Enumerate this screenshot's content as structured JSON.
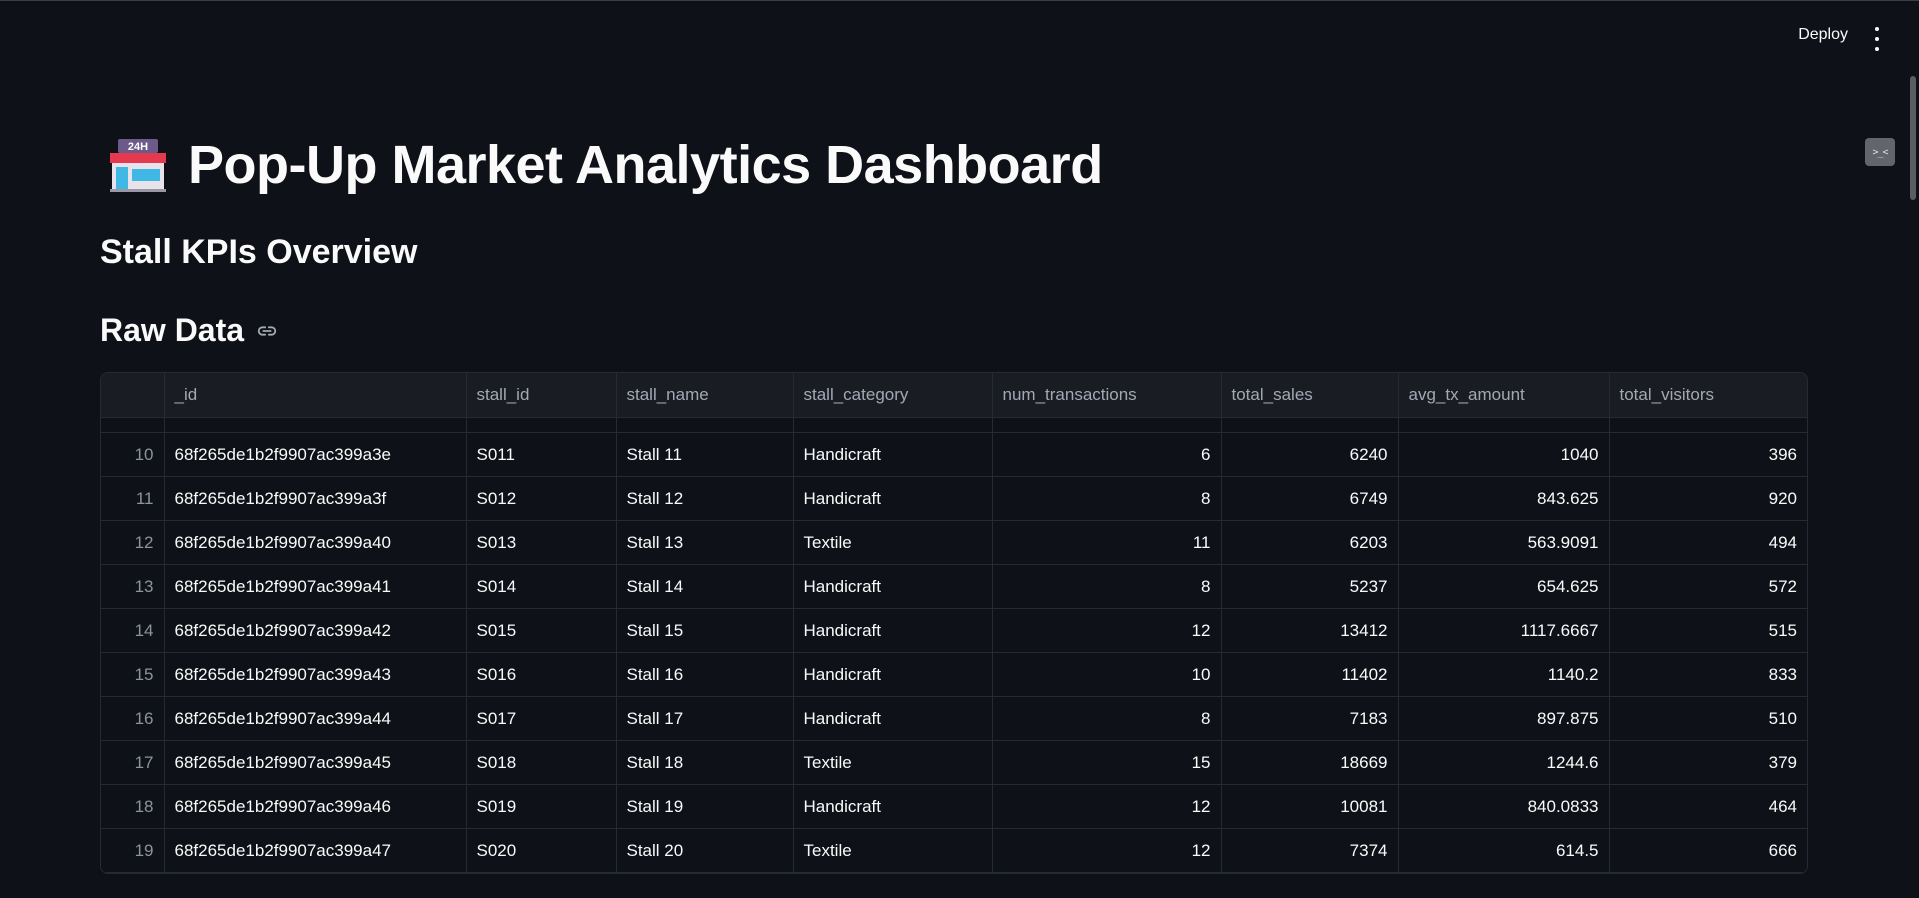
{
  "header": {
    "deploy_label": "Deploy",
    "menu_icon": "vertical-ellipsis-icon",
    "side_widget_text": ">_<"
  },
  "page": {
    "title_icon": "convenience-store-24h-icon",
    "title": "Pop-Up Market Analytics Dashboard",
    "subheader": "Stall KPIs Overview",
    "raw_data_title": "Raw Data",
    "link_icon": "link-icon"
  },
  "table": {
    "columns": [
      "",
      "_id",
      "stall_id",
      "stall_name",
      "stall_category",
      "num_transactions",
      "total_sales",
      "avg_tx_amount",
      "total_visitors"
    ],
    "rows": [
      {
        "idx": "10",
        "id": "68f265de1b2f9907ac399a3e",
        "stall_id": "S011",
        "stall_name": "Stall 11",
        "stall_category": "Handicraft",
        "num_transactions": "6",
        "total_sales": "6240",
        "avg_tx_amount": "1040",
        "total_visitors": "396"
      },
      {
        "idx": "11",
        "id": "68f265de1b2f9907ac399a3f",
        "stall_id": "S012",
        "stall_name": "Stall 12",
        "stall_category": "Handicraft",
        "num_transactions": "8",
        "total_sales": "6749",
        "avg_tx_amount": "843.625",
        "total_visitors": "920"
      },
      {
        "idx": "12",
        "id": "68f265de1b2f9907ac399a40",
        "stall_id": "S013",
        "stall_name": "Stall 13",
        "stall_category": "Textile",
        "num_transactions": "11",
        "total_sales": "6203",
        "avg_tx_amount": "563.9091",
        "total_visitors": "494"
      },
      {
        "idx": "13",
        "id": "68f265de1b2f9907ac399a41",
        "stall_id": "S014",
        "stall_name": "Stall 14",
        "stall_category": "Handicraft",
        "num_transactions": "8",
        "total_sales": "5237",
        "avg_tx_amount": "654.625",
        "total_visitors": "572"
      },
      {
        "idx": "14",
        "id": "68f265de1b2f9907ac399a42",
        "stall_id": "S015",
        "stall_name": "Stall 15",
        "stall_category": "Handicraft",
        "num_transactions": "12",
        "total_sales": "13412",
        "avg_tx_amount": "1117.6667",
        "total_visitors": "515"
      },
      {
        "idx": "15",
        "id": "68f265de1b2f9907ac399a43",
        "stall_id": "S016",
        "stall_name": "Stall 16",
        "stall_category": "Handicraft",
        "num_transactions": "10",
        "total_sales": "11402",
        "avg_tx_amount": "1140.2",
        "total_visitors": "833"
      },
      {
        "idx": "16",
        "id": "68f265de1b2f9907ac399a44",
        "stall_id": "S017",
        "stall_name": "Stall 17",
        "stall_category": "Handicraft",
        "num_transactions": "8",
        "total_sales": "7183",
        "avg_tx_amount": "897.875",
        "total_visitors": "510"
      },
      {
        "idx": "17",
        "id": "68f265de1b2f9907ac399a45",
        "stall_id": "S018",
        "stall_name": "Stall 18",
        "stall_category": "Textile",
        "num_transactions": "15",
        "total_sales": "18669",
        "avg_tx_amount": "1244.6",
        "total_visitors": "379"
      },
      {
        "idx": "18",
        "id": "68f265de1b2f9907ac399a46",
        "stall_id": "S019",
        "stall_name": "Stall 19",
        "stall_category": "Handicraft",
        "num_transactions": "12",
        "total_sales": "10081",
        "avg_tx_amount": "840.0833",
        "total_visitors": "464"
      },
      {
        "idx": "19",
        "id": "68f265de1b2f9907ac399a47",
        "stall_id": "S020",
        "stall_name": "Stall 20",
        "stall_category": "Textile",
        "num_transactions": "12",
        "total_sales": "7374",
        "avg_tx_amount": "614.5",
        "total_visitors": "666"
      }
    ]
  }
}
